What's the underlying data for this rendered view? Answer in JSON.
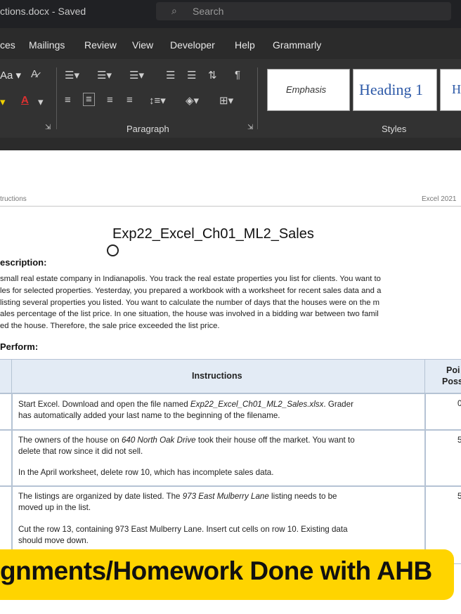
{
  "window": {
    "title": "ctions.docx - Saved",
    "search_placeholder": "Search"
  },
  "menu": {
    "tabs": [
      "ces",
      "Mailings",
      "Review",
      "View",
      "Developer",
      "Help",
      "Grammarly"
    ]
  },
  "ribbon": {
    "groups": [
      "Paragraph",
      "Styles"
    ],
    "styles": [
      "Emphasis",
      "Heading 1",
      "H"
    ],
    "font_size_glyph": "Aa"
  },
  "document": {
    "header_left": "tructions",
    "header_right": "Excel 2021",
    "title": "Exp22_Excel_Ch01_ML2_Sales",
    "section1": "escription:",
    "paragraph": [
      " small real estate company in Indianapolis. You track the real estate properties you list for clients. You want to",
      "les for selected properties. Yesterday, you prepared a workbook with a worksheet for recent sales data and a",
      "listing several properties you listed. You want to calculate the number of days that the houses were on the m",
      "ales percentage of the list price. In one situation, the house was involved in a bidding war between two famil",
      "ed the house. Therefore, the sale price exceeded the list price."
    ],
    "section2": "Perform:",
    "table": {
      "headers": {
        "instructions": "Instructions",
        "points_1": "Poi",
        "points_2": "Poss"
      },
      "rows": [
        {
          "lines": [
            [
              "Start Excel. Download and open the file named ",
              "Exp22_Excel_Ch01_ML2_Sales.xlsx",
              ". Grader"
            ],
            [
              "has automatically added your last name to the beginning of the filename."
            ]
          ],
          "points": "0"
        },
        {
          "lines": [
            [
              "The owners of the house on ",
              "640 North Oak Drive",
              " took their house off the market. You want to"
            ],
            [
              "delete that row since it did not sell."
            ],
            [
              ""
            ],
            [
              "In the April worksheet, delete row 10, which has incomplete sales data."
            ]
          ],
          "points": "5"
        },
        {
          "lines": [
            [
              "The listings are organized by date listed. The ",
              "973 East Mulberry Lane",
              " listing needs to be"
            ],
            [
              "moved up in the list."
            ],
            [
              ""
            ],
            [
              "Cut the row 13, containing 973 East Mulberry Lane. Insert cut cells on row 10. Existing data"
            ],
            [
              "should move down."
            ]
          ],
          "points": "5"
        }
      ]
    }
  },
  "banner": {
    "text": "gnments/Homework Done with AHB"
  },
  "colors": {
    "ribbon_bg": "#323232",
    "menubar_bg": "#2b2b2b",
    "table_header_bg": "#e3ebf5",
    "banner_bg": "#ffd400",
    "heading1_color": "#2e5aa8"
  }
}
